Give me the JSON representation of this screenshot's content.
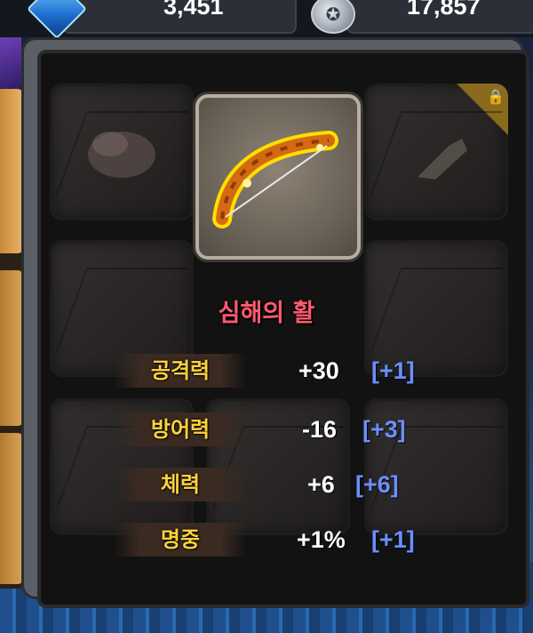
{
  "resources": {
    "gems": "3,451",
    "coins": "17,857",
    "gem_icon": "gem-icon",
    "coin_icon": "coin-icon"
  },
  "item": {
    "name": "심해의 활",
    "icon": "bow-icon"
  },
  "slots": {
    "top_left_icon": "glove-icon",
    "top_right_icon": "boot-icon",
    "top_right_locked": true,
    "lock_icon": "lock-icon"
  },
  "stats": [
    {
      "label": "공격력",
      "value": "+30",
      "bonus": "[+1]"
    },
    {
      "label": "방어력",
      "value": "-16",
      "bonus": "[+3]"
    },
    {
      "label": "체력",
      "value": "+6",
      "bonus": "[+6]"
    },
    {
      "label": "명중",
      "value": "+1%",
      "bonus": "[+1]"
    }
  ],
  "colors": {
    "item_name": "#ff5a6e",
    "stat_label": "#ffd23a",
    "stat_value": "#ffffff",
    "stat_bonus": "#6b8fff"
  }
}
